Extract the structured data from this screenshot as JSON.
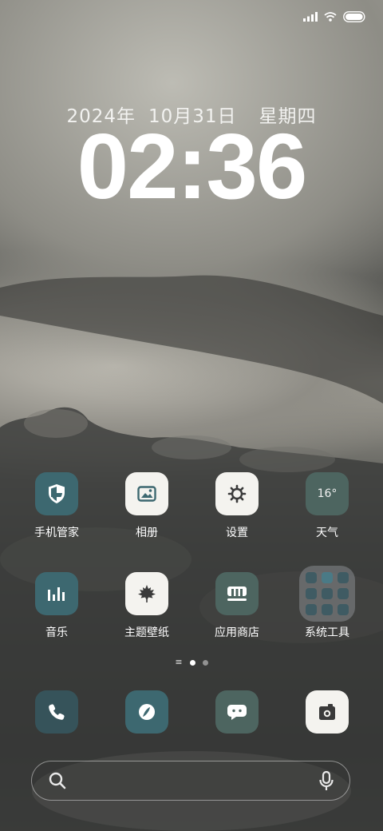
{
  "status_bar": {
    "signal_icon": "signal-icon",
    "wifi_icon": "wifi-icon",
    "battery_icon": "battery-icon"
  },
  "lock": {
    "year": "2024年",
    "date": "10月31日",
    "weekday": "星期四",
    "time": "02:36"
  },
  "apps_row1": [
    {
      "label": "手机管家",
      "icon": "shield-icon"
    },
    {
      "label": "相册",
      "icon": "gallery-icon"
    },
    {
      "label": "设置",
      "icon": "gear-icon"
    },
    {
      "label": "天气",
      "icon": "weather-icon",
      "value": "16°"
    }
  ],
  "apps_row2": [
    {
      "label": "音乐",
      "icon": "music-bars-icon"
    },
    {
      "label": "主题壁纸",
      "icon": "leaf-icon"
    },
    {
      "label": "应用商店",
      "icon": "store-icon"
    },
    {
      "label": "系统工具",
      "icon": "folder-icon"
    }
  ],
  "dock": [
    {
      "name": "phone",
      "icon": "phone-icon"
    },
    {
      "name": "browser",
      "icon": "browser-icon"
    },
    {
      "name": "messages",
      "icon": "message-icon"
    },
    {
      "name": "camera",
      "icon": "camera-icon"
    }
  ],
  "search": {
    "placeholder": "",
    "search_icon": "search-icon",
    "mic_icon": "microphone-icon"
  },
  "page_indicator": {
    "pages": 2,
    "current": 1
  },
  "colors": {
    "teal_tile": "#3d6870",
    "white_tile": "#f4f3ef",
    "green_tile": "#4d6560",
    "dark_tile": "#36535a"
  }
}
